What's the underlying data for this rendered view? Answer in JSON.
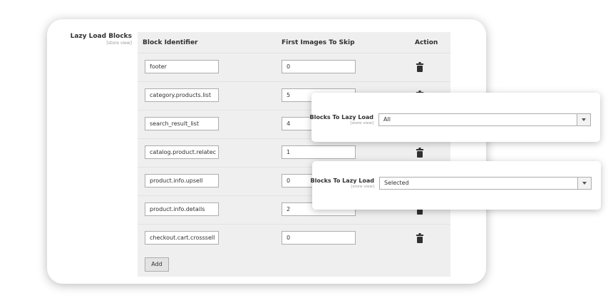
{
  "section": {
    "title": "Lazy Load Blocks",
    "scope": "[store view]"
  },
  "grid": {
    "headers": {
      "block_identifier": "Block Identifier",
      "first_images": "First Images To Skip",
      "action": "Action"
    },
    "rows": [
      {
        "identifier": "footer",
        "skip": "0"
      },
      {
        "identifier": "category.products.list",
        "skip": "5"
      },
      {
        "identifier": "search_result_list",
        "skip": "4"
      },
      {
        "identifier": "catalog.product.relatec",
        "skip": "1"
      },
      {
        "identifier": "product.info.upsell",
        "skip": "0"
      },
      {
        "identifier": "product.info.details",
        "skip": "2"
      },
      {
        "identifier": "checkout.cart.crosssell",
        "skip": "0"
      }
    ],
    "add_label": "Add",
    "delete_icon": "trash-icon"
  },
  "overlays": [
    {
      "label": "Blocks To Lazy Load",
      "scope": "[store view]",
      "value": "All"
    },
    {
      "label": "Blocks To Lazy Load",
      "scope": "[store view]",
      "value": "Selected"
    }
  ]
}
